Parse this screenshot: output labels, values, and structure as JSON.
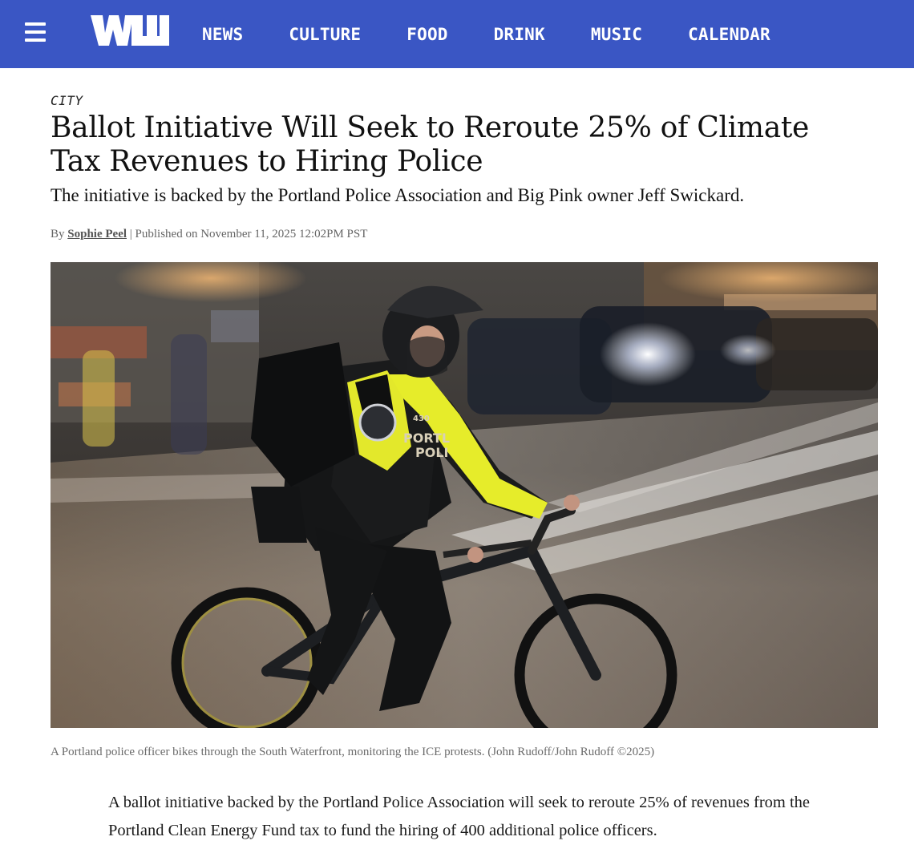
{
  "header": {
    "logo_alt": "WW",
    "nav": [
      {
        "label": "NEWS"
      },
      {
        "label": "CULTURE"
      },
      {
        "label": "FOOD"
      },
      {
        "label": "DRINK"
      },
      {
        "label": "MUSIC"
      },
      {
        "label": "CALENDAR"
      }
    ],
    "colors": {
      "bar": "#3a56c4",
      "nav_text": "#ffffff"
    }
  },
  "article": {
    "section": "CITY",
    "headline": "Ballot Initiative Will Seek to Reroute 25% of Climate Tax Revenues to Hiring Police",
    "dek": "The initiative is backed by the Portland Police Association and Big Pink owner Jeff Swickard.",
    "byline_prefix": "By",
    "author": "Sophie Peel",
    "published": "| Published on November 11, 2025 12:02PM PST",
    "photo": {
      "subject": "police officer on bicycle at night",
      "shirt_text": "PORTLAND POLICE",
      "badge_number": "430",
      "caption": "A Portland police officer bikes through the South Waterfront, monitoring the ICE protests. (John Rudoff/John Rudoff ©2025)"
    },
    "body": [
      "A ballot initiative backed by the Portland Police Association will seek to reroute 25% of revenues from the Portland Clean Energy Fund tax to fund the hiring of 400 additional police officers."
    ]
  }
}
